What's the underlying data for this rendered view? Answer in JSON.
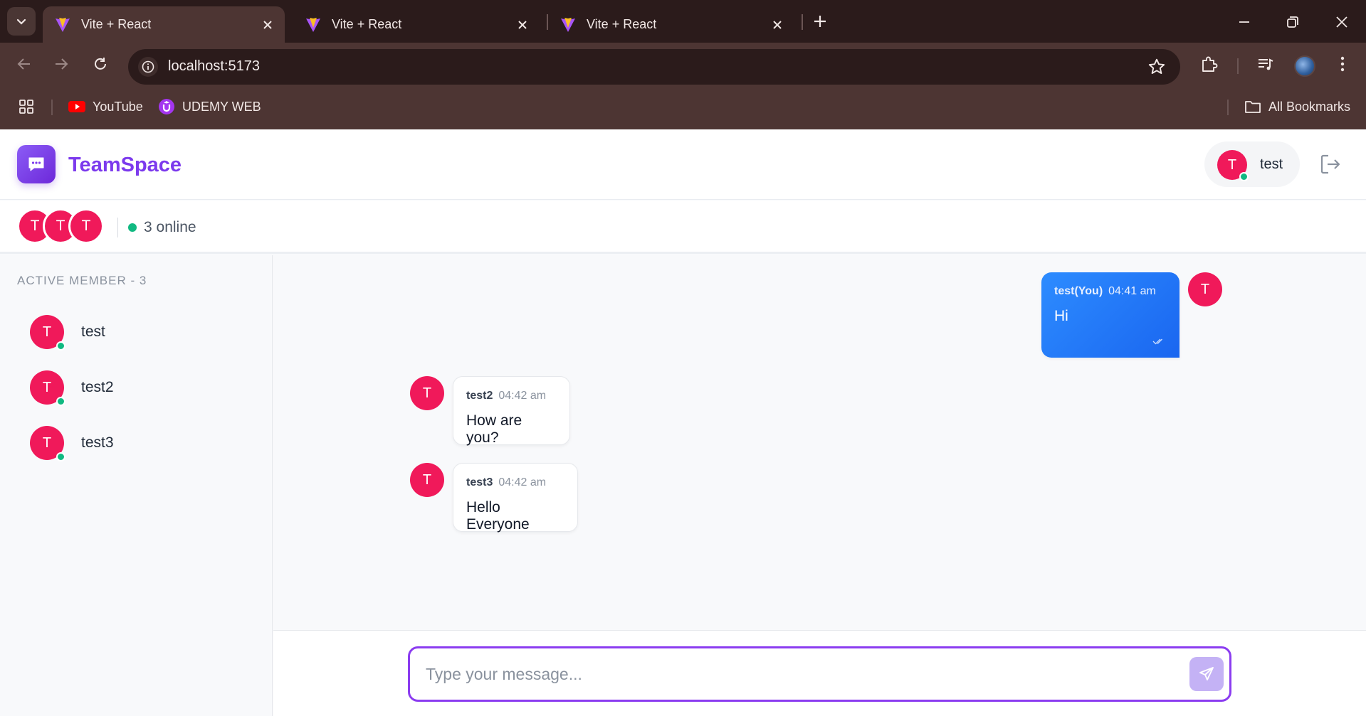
{
  "browser": {
    "tabs": [
      {
        "title": "Vite + React",
        "active": true
      },
      {
        "title": "Vite + React",
        "active": false
      },
      {
        "title": "Vite + React",
        "active": false
      }
    ],
    "url": "localhost:5173",
    "bookmarks": [
      {
        "label": "YouTube",
        "icon": "youtube-icon"
      },
      {
        "label": "UDEMY WEB",
        "icon": "udemy-icon"
      }
    ],
    "all_bookmarks_label": "All Bookmarks"
  },
  "app": {
    "title": "TeamSpace",
    "accent": "#7c3aed",
    "current_user": {
      "initial": "T",
      "name": "test"
    }
  },
  "online": {
    "avatars": [
      "T",
      "T",
      "T"
    ],
    "text": "3 online"
  },
  "sidebar": {
    "title": "ACTIVE MEMBER - 3",
    "members": [
      {
        "initial": "T",
        "name": "test"
      },
      {
        "initial": "T",
        "name": "test2"
      },
      {
        "initial": "T",
        "name": "test3"
      }
    ]
  },
  "messages": [
    {
      "author": "test(You)",
      "time": "04:41 am",
      "text": "Hi",
      "initial": "T",
      "mine": true
    },
    {
      "author": "test2",
      "time": "04:42 am",
      "text": "How are you?",
      "initial": "T",
      "mine": false
    },
    {
      "author": "test3",
      "time": "04:42 am",
      "text": "Hello Everyone",
      "initial": "T",
      "mine": false
    }
  ],
  "composer": {
    "placeholder": "Type your message..."
  },
  "colors": {
    "avatar": "#f0195a",
    "online": "#10b981",
    "my_bubble": "#1a66f0"
  }
}
